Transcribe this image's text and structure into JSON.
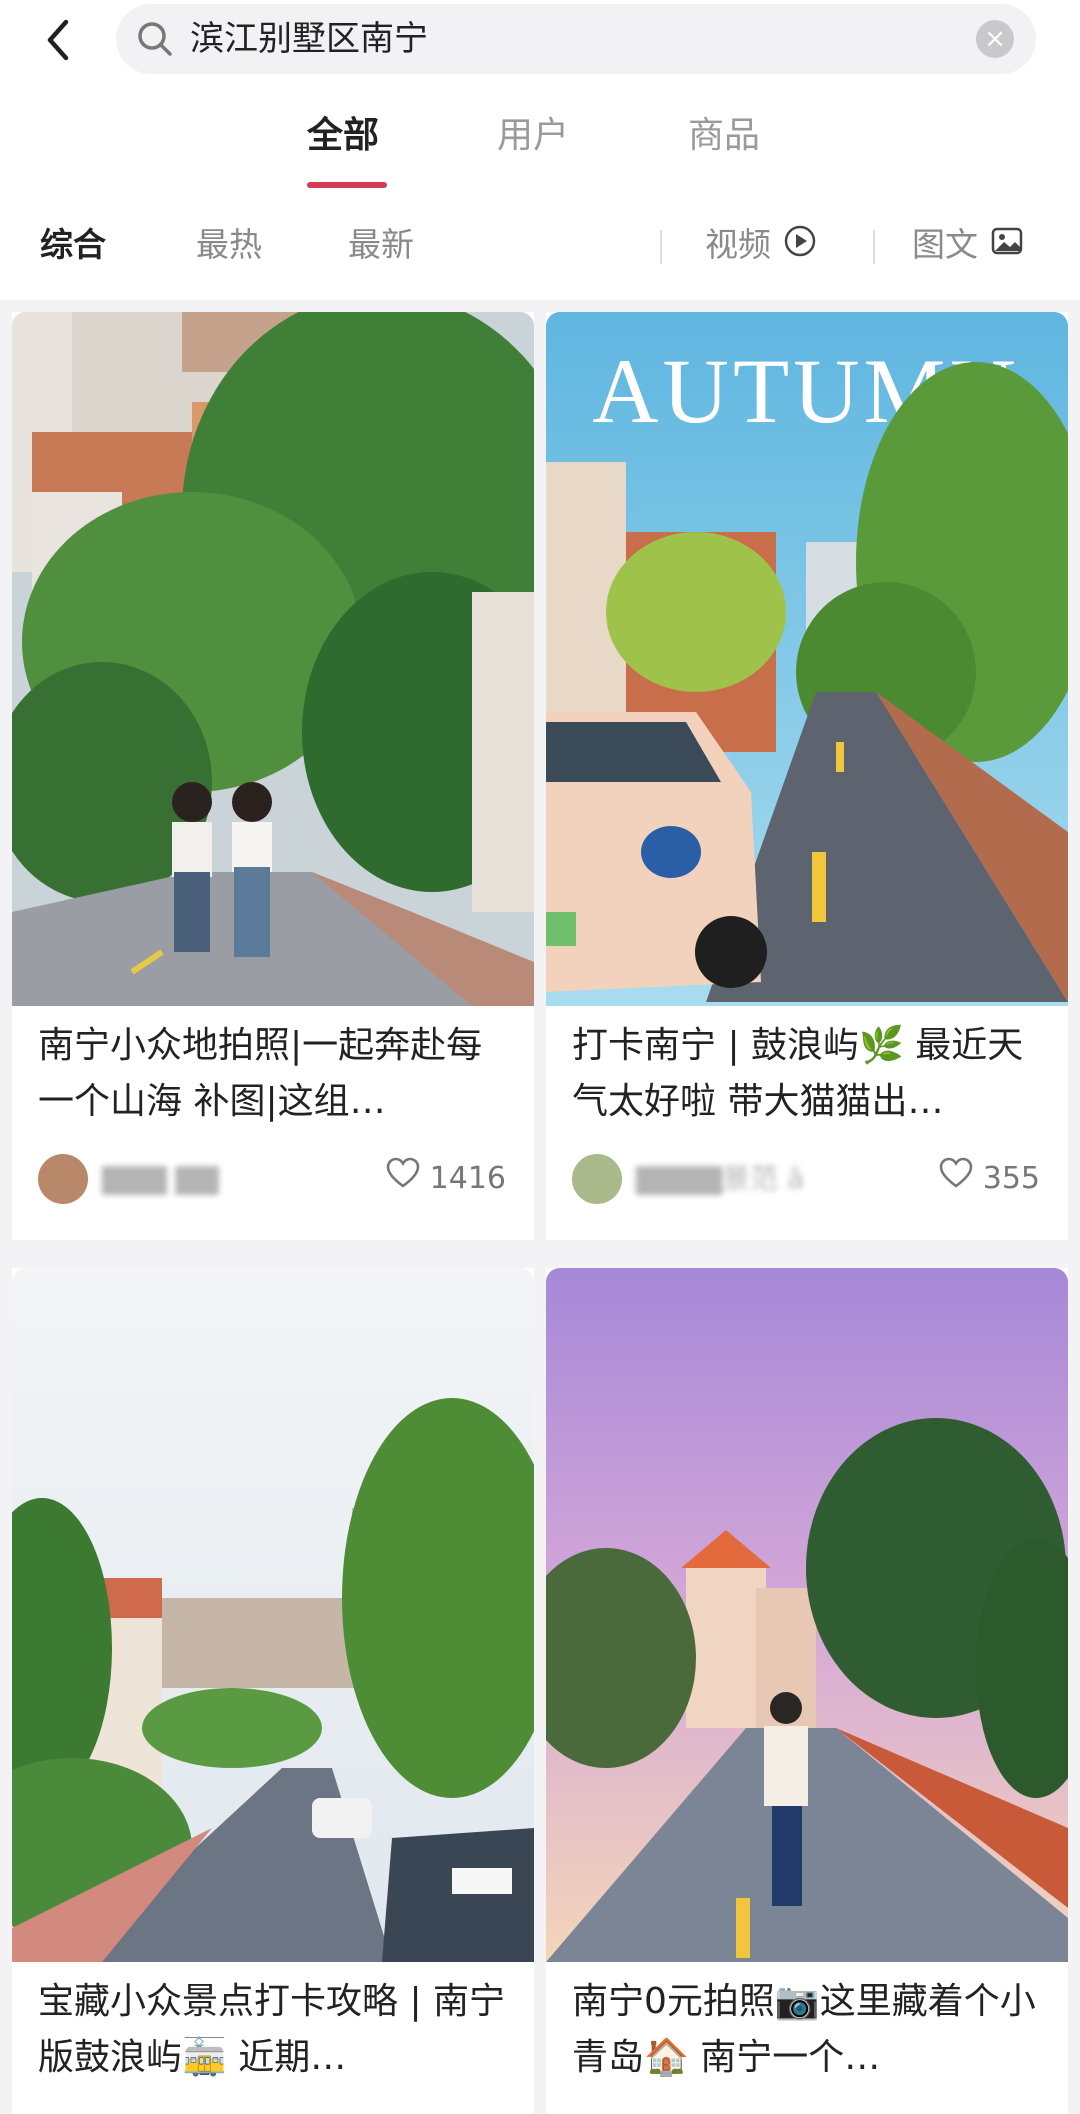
{
  "search": {
    "query": "滨江别墅区南宁"
  },
  "tabs": [
    "全部",
    "用户",
    "商品"
  ],
  "filters": {
    "sort": [
      "综合",
      "最热",
      "最新"
    ],
    "video": "视频",
    "imagetext": "图文"
  },
  "photo_overlay_text": "AUTUMN",
  "cards": [
    {
      "title": "南宁小众地拍照|一起奔赴每一个山海 补图|这组…",
      "user": "▇▇▇ ▇▇",
      "likes": "1416"
    },
    {
      "title": "打卡南宁 | 鼓浪屿🌿 最近天气太好啦 带大猫猫出…",
      "user": "▇▇▇▇景范 ā",
      "likes": "355"
    },
    {
      "title": "宝藏小众景点打卡攻略 | 南宁版鼓浪屿🚋 近期…",
      "user": "",
      "likes": ""
    },
    {
      "title": "南宁0元拍照📷这里藏着个小青岛🏠 南宁一个…",
      "user": "",
      "likes": ""
    }
  ]
}
